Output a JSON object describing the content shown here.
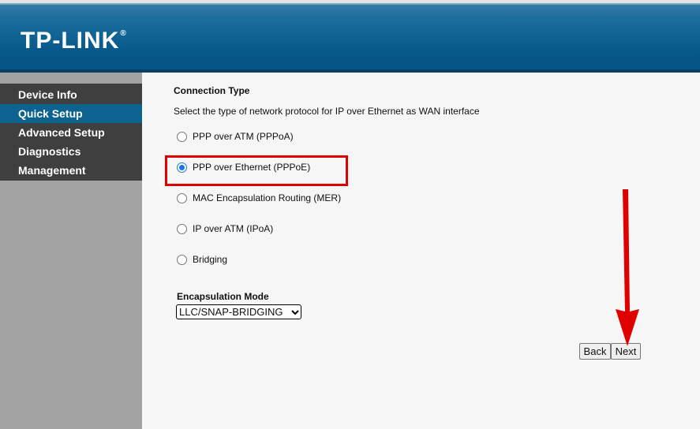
{
  "brand": {
    "name": "TP-LINK",
    "reg": "®"
  },
  "sidebar": {
    "items": [
      {
        "label": "Device Info",
        "active": false
      },
      {
        "label": "Quick Setup",
        "active": true
      },
      {
        "label": "Advanced Setup",
        "active": false
      },
      {
        "label": "Diagnostics",
        "active": false
      },
      {
        "label": "Management",
        "active": false
      }
    ]
  },
  "main": {
    "heading": "Connection Type",
    "description": "Select the type of network protocol for IP over Ethernet as WAN interface",
    "options": [
      {
        "label": "PPP over ATM (PPPoA)",
        "checked": false
      },
      {
        "label": "PPP over Ethernet (PPPoE)",
        "checked": true
      },
      {
        "label": "MAC Encapsulation Routing (MER)",
        "checked": false
      },
      {
        "label": "IP over ATM (IPoA)",
        "checked": false
      },
      {
        "label": "Bridging",
        "checked": false
      }
    ],
    "encapsulation": {
      "label": "Encapsulation Mode",
      "selected": "LLC/SNAP-BRIDGING"
    },
    "buttons": {
      "back": "Back",
      "next": "Next"
    }
  },
  "colors": {
    "highlight": "#e00000",
    "nav_active": "#0d6390",
    "header": "#06598a"
  },
  "icons": {
    "select_arrow": "chevron-down-icon",
    "annotation": "red-arrow-icon"
  }
}
